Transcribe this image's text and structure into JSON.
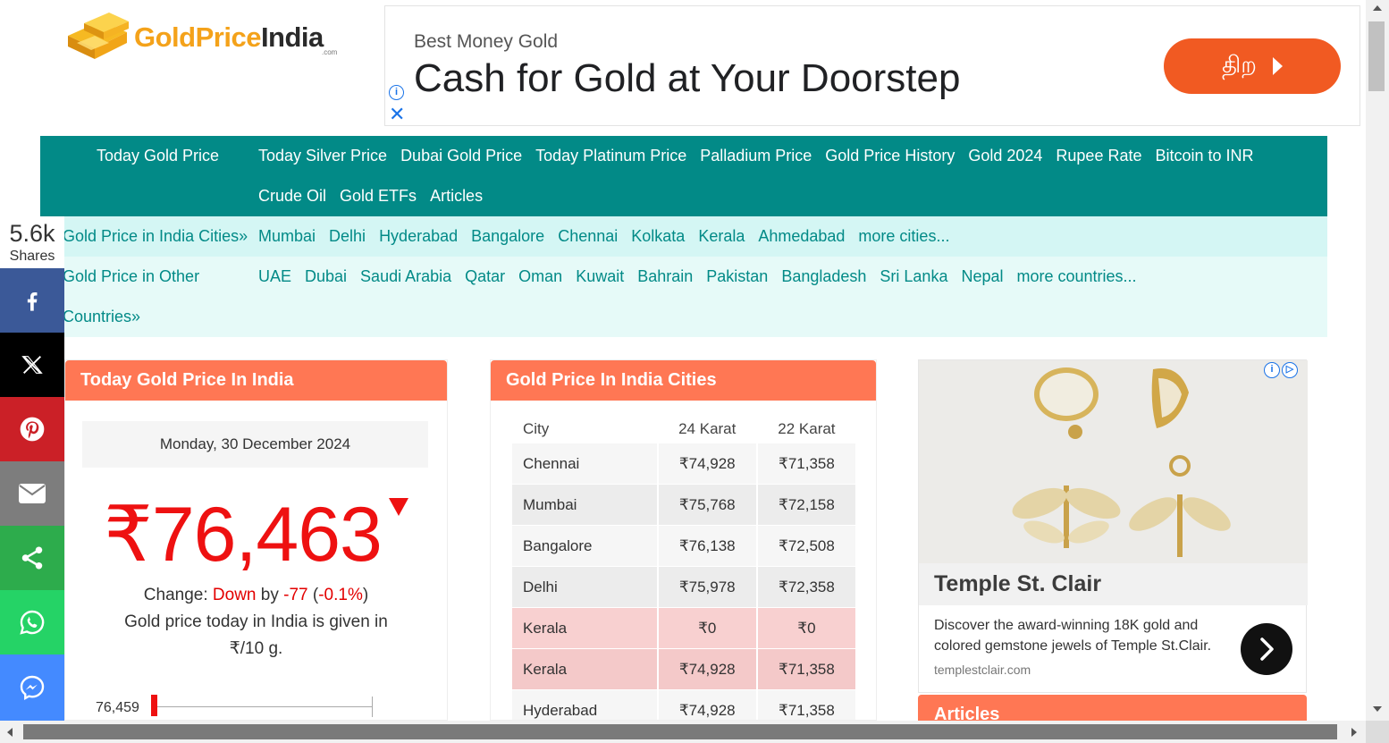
{
  "logo": {
    "gold": "GoldPrice",
    "india": "India",
    "com": ".com"
  },
  "top_ad": {
    "advertiser": "Best Money Gold",
    "headline": "Cash for Gold at Your Doorstep",
    "cta": "திற",
    "cta_color": "#f15a22"
  },
  "nav": {
    "home": "Today Gold Price",
    "links": [
      "Today Silver Price",
      "Dubai Gold Price",
      "Today Platinum Price",
      "Palladium Price",
      "Gold Price History",
      "Gold 2024",
      "Rupee Rate",
      "Bitcoin to INR",
      "Crude Oil",
      "Gold ETFs",
      "Articles"
    ],
    "cities_label": "Gold Price in India Cities»",
    "cities": [
      "Mumbai",
      "Delhi",
      "Hyderabad",
      "Bangalore",
      "Chennai",
      "Kolkata",
      "Kerala",
      "Ahmedabad",
      "more cities..."
    ],
    "countries_label_1": "Gold Price in Other",
    "countries_label_2": "Countries»",
    "countries": [
      "UAE",
      "Dubai",
      "Saudi Arabia",
      "Qatar",
      "Oman",
      "Kuwait",
      "Bahrain",
      "Pakistan",
      "Bangladesh",
      "Sri Lanka",
      "Nepal",
      "more countries..."
    ]
  },
  "share": {
    "count": "5.6k",
    "label": "Shares",
    "buttons": [
      {
        "name": "facebook",
        "icon": "facebook-icon",
        "color": "#3b5998"
      },
      {
        "name": "x",
        "icon": "x-icon",
        "color": "#000000"
      },
      {
        "name": "pinterest",
        "icon": "pinterest-icon",
        "color": "#cb2027"
      },
      {
        "name": "email",
        "icon": "email-icon",
        "color": "#7d7d7d"
      },
      {
        "name": "share",
        "icon": "share-icon",
        "color": "#2dac4c"
      },
      {
        "name": "whatsapp",
        "icon": "whatsapp-icon",
        "color": "#25d366"
      },
      {
        "name": "messenger",
        "icon": "messenger-icon",
        "color": "#448aff"
      }
    ]
  },
  "today_card": {
    "title": "Today Gold Price In India",
    "date": "Monday, 30 December 2024",
    "price": "₹76,463",
    "change_label": "Change:",
    "direction": "Down",
    "by": "by",
    "change_value": "-77",
    "change_pct": "-0.1%",
    "note": "Gold price today in India is given in ₹/10 g.",
    "low_value": "76,459"
  },
  "cities_card": {
    "title": "Gold Price In India Cities",
    "columns": [
      "City",
      "24 Karat",
      "22 Karat"
    ],
    "rows": [
      [
        "Chennai",
        "₹74,928",
        "₹71,358"
      ],
      [
        "Mumbai",
        "₹75,768",
        "₹72,158"
      ],
      [
        "Bangalore",
        "₹76,138",
        "₹72,508"
      ],
      [
        "Delhi",
        "₹75,978",
        "₹72,358"
      ],
      [
        "Kerala",
        "₹0",
        "₹0"
      ],
      [
        "Kerala",
        "₹74,928",
        "₹71,358"
      ],
      [
        "Hyderabad",
        "₹74,928",
        "₹71,358"
      ]
    ]
  },
  "right_ad": {
    "title": "Temple St. Clair",
    "description": "Discover the award-winning 18K gold and colored gemstone jewels of Temple St.Clair.",
    "domain": "templestclair.com"
  },
  "articles": {
    "title": "Articles"
  }
}
